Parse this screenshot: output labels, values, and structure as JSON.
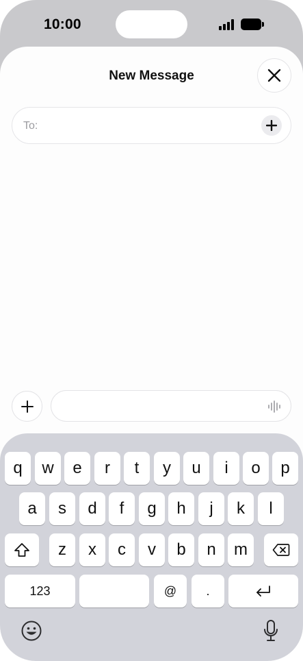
{
  "status_bar": {
    "time": "10:00",
    "icons": [
      "cellular-signal-icon",
      "battery-icon"
    ]
  },
  "sheet": {
    "title": "New Message",
    "close_icon": "close-icon"
  },
  "recipient": {
    "label": "To:",
    "add_icon": "plus-icon"
  },
  "compose": {
    "attach_icon": "plus-icon",
    "input_value": "",
    "voice_icon": "waveform-icon"
  },
  "keyboard": {
    "row1": [
      "q",
      "w",
      "e",
      "r",
      "t",
      "y",
      "u",
      "i",
      "o",
      "p"
    ],
    "row2": [
      "a",
      "s",
      "d",
      "f",
      "g",
      "h",
      "j",
      "k",
      "l"
    ],
    "row3": [
      "z",
      "x",
      "c",
      "v",
      "b",
      "n",
      "m"
    ],
    "numbers_key": "123",
    "space_key": "",
    "at_key": "@",
    "period_key": ".",
    "shift_icon": "shift-icon",
    "delete_icon": "delete-icon",
    "return_icon": "return-icon",
    "emoji_icon": "emoji-icon",
    "mic_icon": "microphone-icon"
  },
  "colors": {
    "frame": "#c9c9cc",
    "sheet": "#fdfdfd",
    "keyboard": "#d2d3da",
    "key": "#ffffff"
  }
}
